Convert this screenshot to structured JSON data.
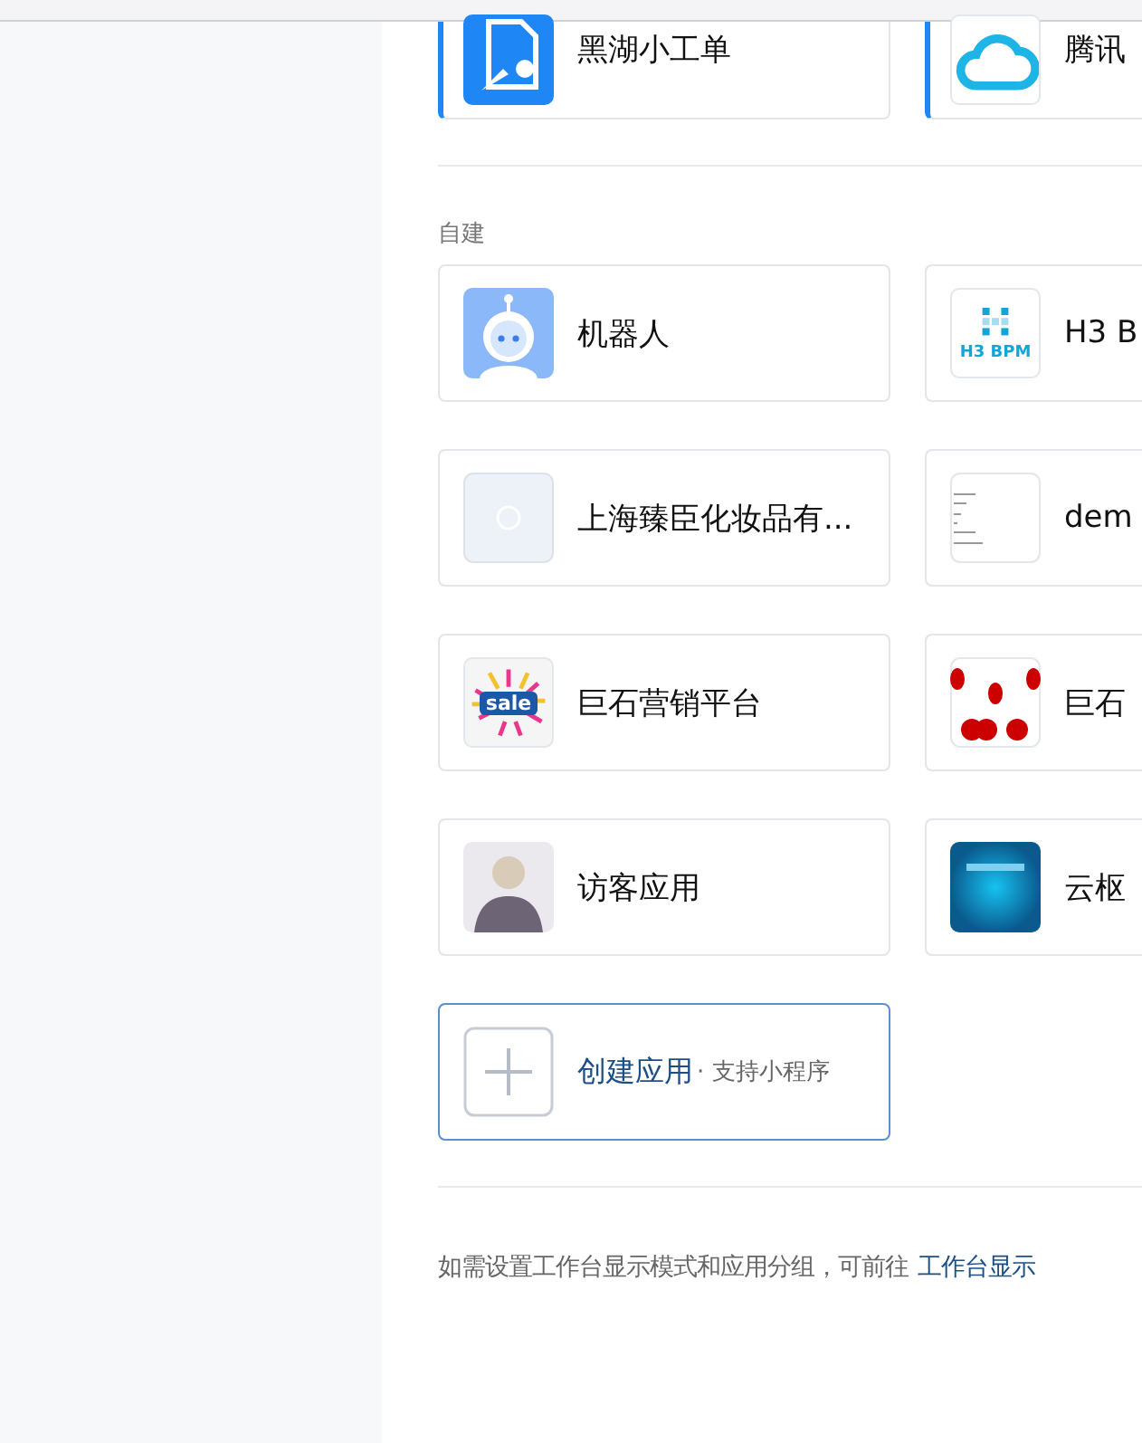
{
  "pinned_apps": [
    {
      "name": "黑湖小工单",
      "kind": "form",
      "accent": true
    },
    {
      "name": "腾讯",
      "kind": "cloud",
      "accent": true
    }
  ],
  "section": {
    "title": "自建",
    "apps": [
      {
        "name": "机器人",
        "kind": "robot"
      },
      {
        "name": "H3 B",
        "kind": "logo",
        "logo_text": "H3 BPM"
      },
      {
        "name": "上海臻臣化妆品有...",
        "kind": "pale"
      },
      {
        "name": "dem",
        "kind": "document"
      },
      {
        "name": "巨石营销平台",
        "kind": "sale",
        "logo_text": "sale"
      },
      {
        "name": "巨石",
        "kind": "diagram"
      },
      {
        "name": "访客应用",
        "kind": "photo"
      },
      {
        "name": "云枢",
        "kind": "screen"
      }
    ]
  },
  "create": {
    "label": "创建应用",
    "hint": "· 支持小程序"
  },
  "footer": {
    "text": "如需设置工作台显示模式和应用分组，可前往",
    "link": "工作台显示"
  }
}
